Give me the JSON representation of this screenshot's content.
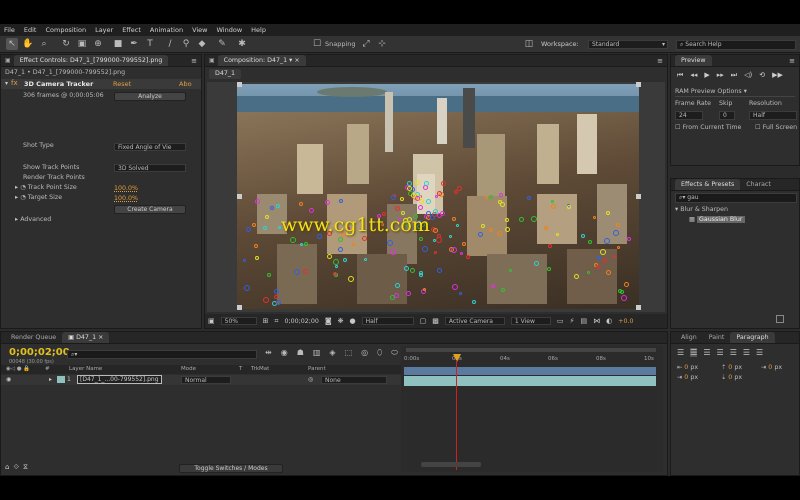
{
  "menu": [
    "File",
    "Edit",
    "Composition",
    "Layer",
    "Effect",
    "Animation",
    "View",
    "Window",
    "Help"
  ],
  "toolbar": {
    "tools": [
      "selection-tool-icon",
      "hand-tool-icon",
      "zoom-tool-icon",
      "rotate-tool-icon",
      "camera-tool-icon",
      "pan-behind-icon",
      "rect-mask-icon",
      "pen-tool-icon",
      "type-tool-icon",
      "brush-tool-icon",
      "clone-stamp-icon",
      "eraser-tool-icon",
      "roto-brush-icon",
      "puppet-pin-icon"
    ],
    "snapping": "Snapping",
    "workspace_label": "Workspace:",
    "workspace_value": "Standard",
    "search_placeholder": "Search Help"
  },
  "effect_controls": {
    "tab": "Effect Controls: D47_1_[799000-799552].png",
    "source": "D47_1 • D47_1_[799000-799552].png",
    "effect_name": "3D Camera Tracker",
    "reset": "Reset",
    "about": "Abo",
    "frames_info": "306 frames @ 0;00:05:06",
    "analyze": "Analyze",
    "shot_type_label": "Shot Type",
    "shot_type_value": "Fixed Angle of Vie",
    "show_track_points_label": "Show Track Points",
    "show_track_points_value": "3D Solved",
    "render_track_points": "Render Track Points",
    "track_point_size_label": "Track Point Size",
    "track_point_size_value": "100.0%",
    "target_size_label": "Target Size",
    "target_size_value": "100.0%",
    "create_camera": "Create Camera",
    "advanced": "Advanced"
  },
  "composition": {
    "tab": "Composition: D47_1",
    "subtab": "D47_1",
    "zoom": "50%",
    "timecode": "0;00;02;00",
    "resolution": "Half",
    "camera": "Active Camera",
    "view": "1 View",
    "offset": "+0.0",
    "watermark": "www.cg1tt.com"
  },
  "preview": {
    "tab": "Preview",
    "options": "RAM Preview Options",
    "frame_rate_label": "Frame Rate",
    "frame_rate_value": "24",
    "skip_label": "Skip",
    "skip_value": "0",
    "resolution_label": "Resolution",
    "resolution_value": "Half",
    "from_current": "From Current Time",
    "full_screen": "Full Screen"
  },
  "effects_presets": {
    "tab": "Effects & Presets",
    "tab2": "Charact",
    "search": "gau",
    "category": "Blur & Sharpen",
    "item": "Gaussian Blur"
  },
  "timeline": {
    "tab1": "Render Queue",
    "tab2": "D47_1",
    "timecode": "0;00;02;00",
    "timecode_sub": "00048 (30.00 fps)",
    "col_layer": "Layer Name",
    "col_mode": "Mode",
    "col_t": "T",
    "col_trkmat": "TrkMat",
    "col_parent": "Parent",
    "layer_num": "1",
    "layer_name": "[D47_1_...00-799552].png",
    "layer_mode": "Normal",
    "layer_parent": "None",
    "ruler": [
      "0:00s",
      "02s",
      "04s",
      "06s",
      "08s",
      "10s"
    ],
    "toggle": "Toggle Switches / Modes"
  },
  "paragraph": {
    "tab1": "Align",
    "tab2": "Paint",
    "tab3": "Paragraph",
    "px": "px",
    "zero": "0"
  },
  "colors": {
    "accent_orange": "#e0a040",
    "playhead_red": "#d02020",
    "layer_bar": "#8fc1c0",
    "workarea_blue": "#5a7aa0"
  }
}
